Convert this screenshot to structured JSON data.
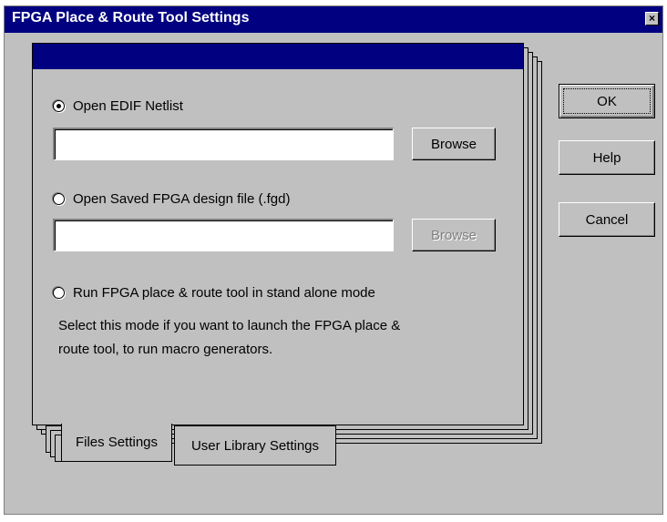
{
  "window": {
    "title": "FPGA Place & Route Tool Settings",
    "close_glyph": "×"
  },
  "options": [
    {
      "label": "Open EDIF Netlist",
      "selected": true
    },
    {
      "label": "Open Saved FPGA design file (.fgd)",
      "selected": false
    },
    {
      "label": "Run FPGA place & route tool in stand alone mode",
      "selected": false
    }
  ],
  "inputs": {
    "edif_path": {
      "value": "",
      "placeholder": ""
    },
    "fgd_path": {
      "value": "",
      "placeholder": ""
    }
  },
  "browse_buttons": {
    "edif": {
      "label": "Browse",
      "enabled": true
    },
    "fgd": {
      "label": "Browse",
      "enabled": false
    }
  },
  "standalone_description": {
    "line1": "Select this mode if you want to launch the FPGA place &",
    "line2": "route tool, to run macro generators."
  },
  "tabs": [
    {
      "label": "Files Settings",
      "active": true
    },
    {
      "label": "User Library Settings",
      "active": false
    }
  ],
  "dialog_buttons": {
    "ok": "OK",
    "help": "Help",
    "cancel": "Cancel"
  },
  "colors": {
    "titlebar": "#000080",
    "face": "#c0c0c0"
  }
}
